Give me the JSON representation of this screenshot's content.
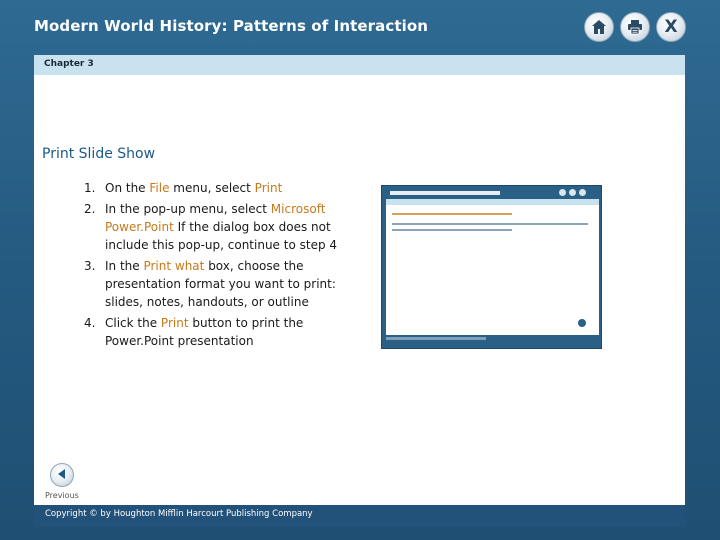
{
  "header": {
    "title": "Modern World History: Patterns of Interaction",
    "buttons": [
      {
        "icon": "home-icon"
      },
      {
        "icon": "print-icon"
      },
      {
        "icon": "close-icon",
        "label": "X"
      }
    ]
  },
  "chapter_bar": {
    "label": "Chapter 3"
  },
  "main": {
    "section_title": "Print Slide Show",
    "steps": [
      {
        "num": "1.",
        "parts": [
          "On the ",
          "File",
          " menu, select ",
          "Print"
        ]
      },
      {
        "num": "2.",
        "parts": [
          "In the pop-up menu, select ",
          "Microsoft Power.Point",
          " If the dialog box does not include this pop-up, continue to step 4"
        ]
      },
      {
        "num": "3.",
        "parts": [
          "In the ",
          "Print what",
          " box, choose the presentation format you want to print: slides, notes, handouts, or outline"
        ]
      },
      {
        "num": "4.",
        "parts": [
          "Click the ",
          "Print",
          " button to print the Power.Point presentation"
        ]
      }
    ]
  },
  "nav": {
    "previous_label": "Previous"
  },
  "footer": {
    "copyright": "Copyright © by Houghton Mifflin Harcourt Publishing Company"
  },
  "colors": {
    "frame": "#2a5f86",
    "chapter_bar": "#c8e3ef",
    "title_text": "#1b5a86",
    "highlight": "#c67a1a"
  }
}
